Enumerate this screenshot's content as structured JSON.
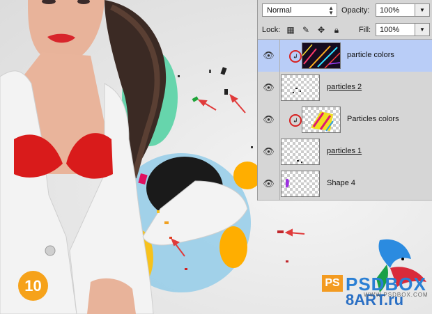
{
  "step": {
    "number": "10"
  },
  "layers_panel": {
    "blend_mode": "Normal",
    "opacity_label": "Opacity:",
    "opacity_value": "100%",
    "lock_label": "Lock:",
    "fill_label": "Fill:",
    "fill_value": "100%",
    "layers": [
      {
        "name": "particle colors",
        "clipped": true,
        "selected": true,
        "thumb": "particle-colors"
      },
      {
        "name": "particles 2",
        "clipped": false,
        "selected": false,
        "thumb": "transparent"
      },
      {
        "name": "Particles colors",
        "clipped": true,
        "selected": false,
        "thumb": "stripes"
      },
      {
        "name": "particles 1",
        "clipped": false,
        "selected": false,
        "thumb": "transparent"
      },
      {
        "name": "Shape 4",
        "clipped": false,
        "selected": false,
        "thumb": "shape"
      }
    ]
  },
  "watermark": {
    "ps": "PS",
    "psdbox": "PSDBOX",
    "url": "WWW.PSDBOX.COM",
    "site": "8ART.ru"
  },
  "colors": {
    "accent_orange": "#f6a21a",
    "selection_blue": "#b9cdf7",
    "jacket_white": "#f3f3f3",
    "bra_red": "#d91b1b",
    "arrow_red": "#e03a3a"
  }
}
